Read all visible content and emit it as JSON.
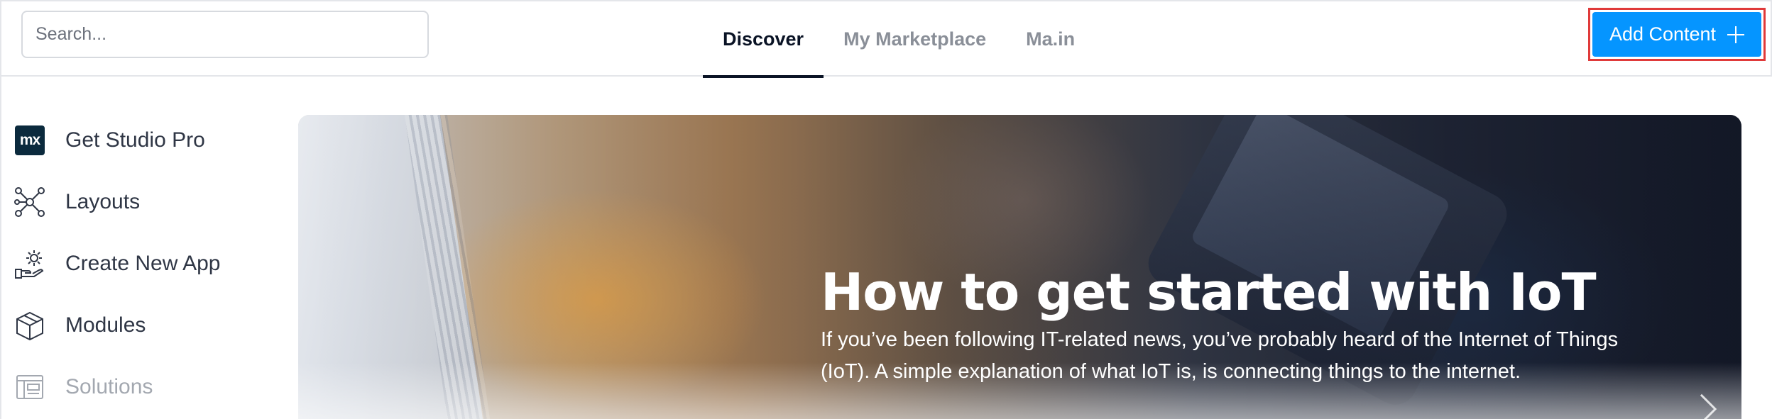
{
  "search": {
    "placeholder": "Search..."
  },
  "tabs": [
    {
      "label": "Discover",
      "active": true
    },
    {
      "label": "My Marketplace",
      "active": false
    },
    {
      "label": "Ma.in",
      "active": false
    }
  ],
  "header": {
    "add_button_label": "Add Content"
  },
  "sidebar": {
    "items": [
      {
        "label": "Get Studio Pro",
        "icon": "mx-logo-icon",
        "logo_text": "mx"
      },
      {
        "label": "Layouts",
        "icon": "network-nodes-icon"
      },
      {
        "label": "Create New App",
        "icon": "hand-gear-icon"
      },
      {
        "label": "Modules",
        "icon": "cube-icon"
      },
      {
        "label": "Solutions",
        "icon": "layout-panel-icon"
      }
    ]
  },
  "hero": {
    "title": "How to get started with IoT",
    "description": "If you’ve been following IT-related news, you’ve probably heard of the Internet of Things (IoT). A simple explanation of what IoT is, is connecting things to the internet."
  },
  "colors": {
    "accent": "#0595ff",
    "highlight_border": "#e03a3a",
    "text_dark": "#0a1325",
    "text_muted": "#8a8f98"
  }
}
